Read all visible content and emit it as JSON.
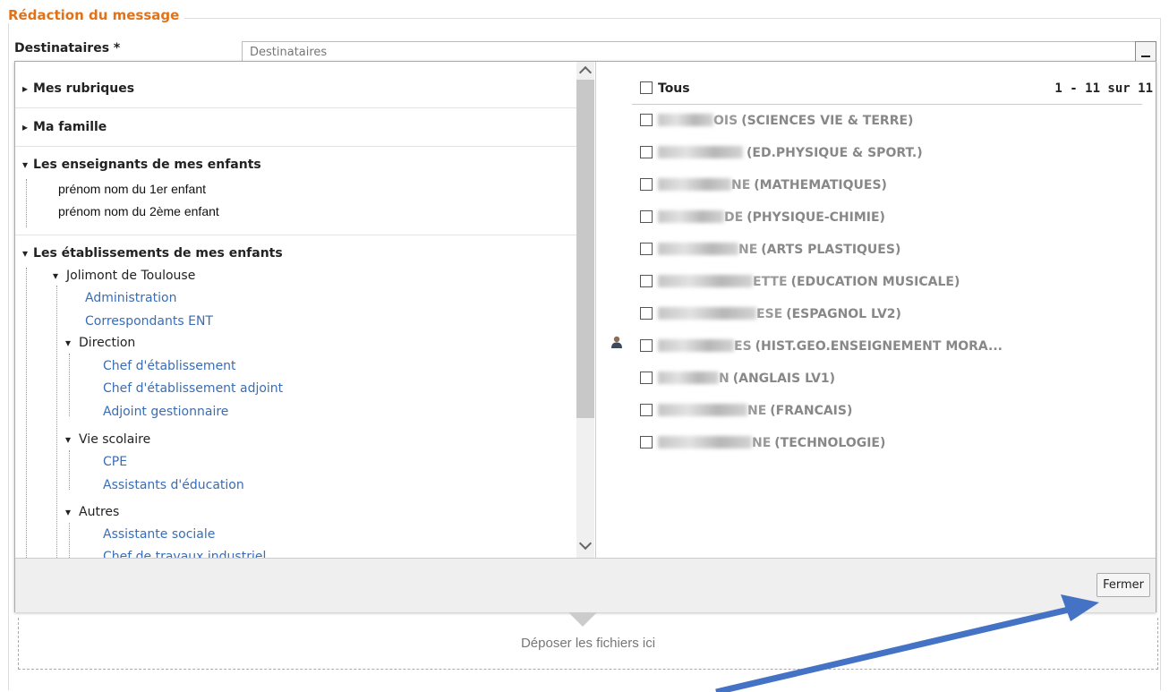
{
  "legend": "Rédaction du message",
  "recipients": {
    "label": "Destinataires *",
    "placeholder": "Destinataires"
  },
  "left_panel": {
    "mes_rubriques": "Mes rubriques",
    "ma_famille": "Ma famille",
    "enseignants": "Les enseignants de mes enfants",
    "enfants": [
      "prénom nom du 1er enfant",
      "prénom nom du 2ème enfant"
    ],
    "etablissements": "Les établissements de mes enfants",
    "school": "Jolimont de Toulouse",
    "school_links": [
      "Administration",
      "Correspondants ENT"
    ],
    "direction": "Direction",
    "direction_links": [
      "Chef d'établissement",
      "Chef d'établissement adjoint",
      "Adjoint gestionnaire"
    ],
    "vie_scolaire": "Vie scolaire",
    "vie_links": [
      "CPE",
      "Assistants d'éducation"
    ],
    "autres": "Autres",
    "autres_links": [
      "Assistante sociale",
      "Chef de travaux industriel"
    ]
  },
  "right_panel": {
    "tous": "Tous",
    "count": "1 - 11 sur 11",
    "teachers": [
      {
        "blur_tail": "OIS",
        "subject": "(SCIENCES VIE & TERRE)"
      },
      {
        "blur_tail": "",
        "subject": "(ED.PHYSIQUE & SPORT.)"
      },
      {
        "blur_tail": "NE",
        "subject": "(MATHEMATIQUES)"
      },
      {
        "blur_tail": "DE",
        "subject": "(PHYSIQUE-CHIMIE)"
      },
      {
        "blur_tail": "NE",
        "subject": "(ARTS PLASTIQUES)"
      },
      {
        "blur_tail": "ETTE",
        "subject": "(EDUCATION MUSICALE)"
      },
      {
        "blur_tail": "ESE",
        "subject": "(ESPAGNOL LV2)"
      },
      {
        "blur_tail": "ES",
        "subject": "(HIST.GEO.ENSEIGNEMENT MORA..."
      },
      {
        "blur_tail": "N",
        "subject": "(ANGLAIS LV1)"
      },
      {
        "blur_tail": "NE",
        "subject": "(FRANCAIS)"
      },
      {
        "blur_tail": "NE",
        "subject": "(TECHNOLOGIE)"
      }
    ]
  },
  "close_label": "Fermer",
  "dropzone": "Déposer les fichiers ici",
  "colors": {
    "legend": "#e0731a",
    "link": "#3a6db5",
    "arrow": "#4472c4"
  }
}
